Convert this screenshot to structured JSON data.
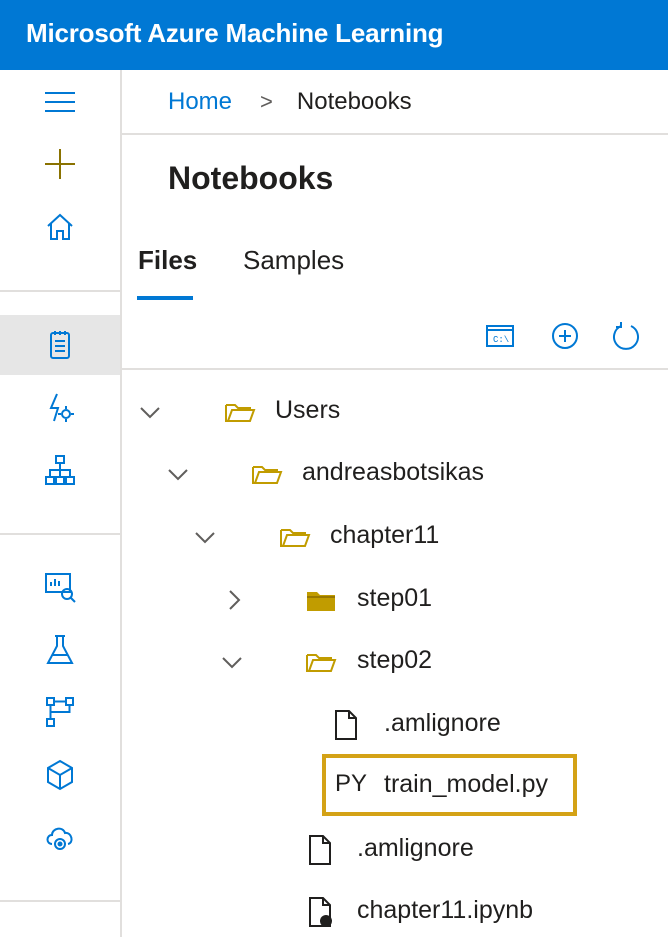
{
  "app": {
    "title": "Microsoft Azure Machine Learning"
  },
  "breadcrumb": {
    "home": "Home",
    "separator": ">",
    "current": "Notebooks"
  },
  "page": {
    "title": "Notebooks"
  },
  "tabs": [
    {
      "label": "Files",
      "active": true
    },
    {
      "label": "Samples",
      "active": false
    }
  ],
  "toolbar": {
    "icons": [
      "terminal-icon",
      "add-circle-icon",
      "refresh-icon"
    ]
  },
  "tree": [
    {
      "label": "Users",
      "type": "folder",
      "state": "expanded"
    },
    {
      "label": "andreasbotsikas",
      "type": "folder",
      "state": "expanded"
    },
    {
      "label": "chapter11",
      "type": "folder",
      "state": "expanded"
    },
    {
      "label": "step01",
      "type": "folder",
      "state": "collapsed"
    },
    {
      "label": "step02",
      "type": "folder",
      "state": "expanded"
    },
    {
      "label": ".amlignore",
      "type": "file"
    },
    {
      "label": "train_model.py",
      "type": "python",
      "tag": "PY",
      "highlighted": true
    },
    {
      "label": ".amlignore",
      "type": "file"
    },
    {
      "label": "chapter11.ipynb",
      "type": "notebook"
    }
  ],
  "colors": {
    "brand": "#0078d4",
    "highlight": "#d4a216",
    "folder": "#c19c00"
  },
  "nav_icons": [
    "hamburger-icon",
    "plus-icon",
    "home-icon",
    "notebook-icon",
    "automl-icon",
    "designer-icon",
    "datasets-icon",
    "experiments-icon",
    "pipelines-icon",
    "models-icon",
    "endpoints-icon"
  ]
}
